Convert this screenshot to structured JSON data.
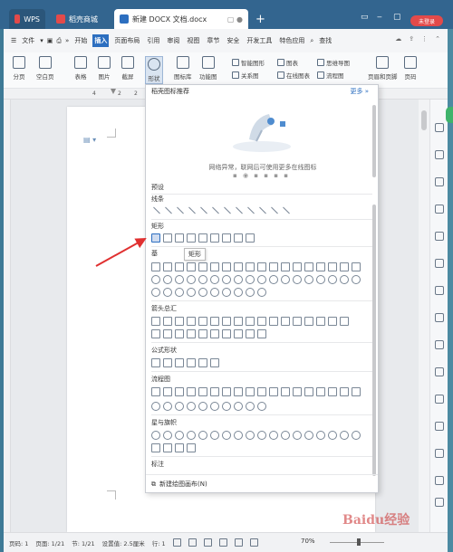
{
  "titlebar": {
    "tabs": [
      {
        "label": "WPS",
        "color": "#2b567a"
      },
      {
        "label": "稻壳商城",
        "color": "#e34a4a"
      },
      {
        "label": "新建 DOCX 文档.docx",
        "color": "#2d6fc0"
      }
    ],
    "new_tab": "+",
    "login_label": "未登录"
  },
  "menubar": {
    "file": "文件",
    "items": [
      "开始",
      "插入",
      "页面布局",
      "引用",
      "审阅",
      "视图",
      "章节",
      "安全",
      "开发工具",
      "特色应用"
    ],
    "active": "插入",
    "search": "查找"
  },
  "toolbar": {
    "items": [
      "分页",
      "空白页",
      "表格",
      "图片",
      "截屏",
      "形状",
      "图标库",
      "功能图",
      "关系图",
      "智能图形",
      "图表",
      "思维导图",
      "在线图表",
      "流程图",
      "页眉和页脚",
      "页码"
    ]
  },
  "ruler": {
    "numbers": [
      "4",
      "2",
      "2"
    ]
  },
  "dropdown": {
    "header": "稻壳图标推荐",
    "more": "更多 »",
    "network_msg": "网络异常，联网后可使用更多在线图标",
    "sections": [
      {
        "title": "预设",
        "count": 0
      },
      {
        "title": "线条",
        "count": 12
      },
      {
        "title": "矩形",
        "count": 9
      },
      {
        "title": "基",
        "count": 32
      },
      {
        "title": "箭头总汇",
        "count": 28
      },
      {
        "title": "公式形状",
        "count": 6
      },
      {
        "title": "流程图",
        "count": 28
      },
      {
        "title": "星与旗帜",
        "count": 20
      },
      {
        "title": "标注",
        "count": 0
      }
    ],
    "tooltip": "矩形",
    "footer": "新建绘图画布(N)"
  },
  "statusbar": {
    "page": "页码: 1",
    "pages": "页面: 1/21",
    "section": "节: 1/21",
    "setting": "设置值: 2.5厘米",
    "row": "行: 1",
    "zoom": "70%"
  },
  "watermark": "Baidu经验",
  "colors": {
    "accent": "#2d6fc0",
    "title_bg": "#33658f",
    "arrow": "#e03030"
  }
}
